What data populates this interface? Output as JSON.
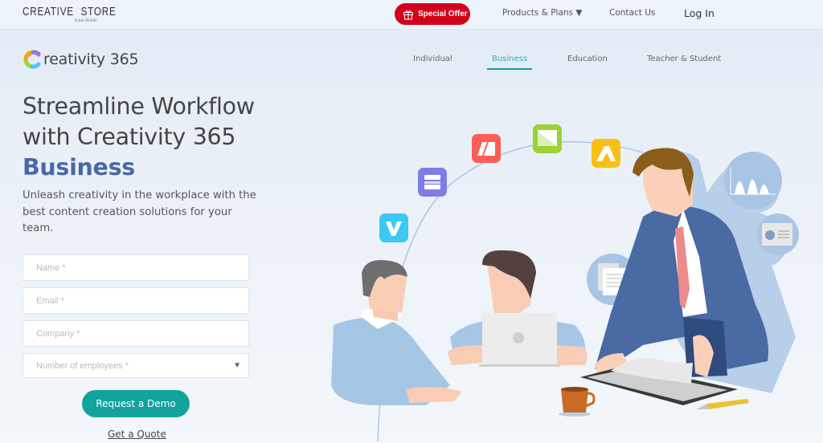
{
  "header": {
    "store_name": "CREATIVE  STORE",
    "store_sub": "Kdan Mobile",
    "special_offer": "Special Offer",
    "products_plans": "Products & Plans ▼",
    "contact_us": "Contact Us",
    "log_in": "Log In"
  },
  "brand": {
    "name": "reativity 365",
    "logo_icon": "creativity-c-logo"
  },
  "tabs": [
    {
      "label": "Individual",
      "active": false
    },
    {
      "label": "Business",
      "active": true
    },
    {
      "label": "Education",
      "active": false
    },
    {
      "label": "Teacher & Student",
      "active": false
    }
  ],
  "hero": {
    "line1": "Streamline Workflow",
    "line2": "with Creativity 365",
    "accent": "Business",
    "subtitle": "Unleash creativity in the workplace with the best content creation solutions for your team."
  },
  "form": {
    "name_placeholder": "Name *",
    "email_placeholder": "Email *",
    "company_placeholder": "Company *",
    "employees_placeholder": "Number of employees *",
    "employees_arrow": "▼",
    "request_demo": "Request a Demo",
    "get_quote": "Get a Quote"
  },
  "illustration": {
    "app_icons": [
      "video-app-icon",
      "slides-app-icon",
      "notes-app-icon",
      "image-app-icon",
      "animation-app-icon"
    ],
    "colors": {
      "accent_red": "#d4001b",
      "accent_teal": "#12a39d",
      "accent_blue": "#4a68a6"
    }
  }
}
